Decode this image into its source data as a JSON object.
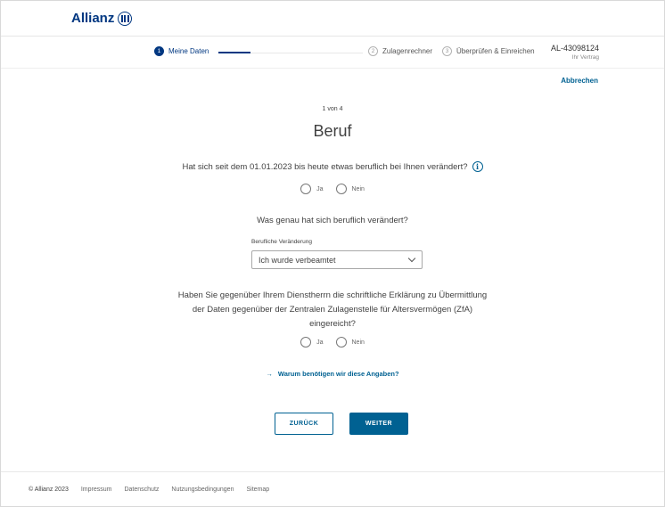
{
  "header": {
    "logo_text": "Allianz"
  },
  "stepper": {
    "steps": [
      {
        "num": "1",
        "label": "Meine Daten"
      },
      {
        "num": "2",
        "label": "Zulagenrechner"
      },
      {
        "num": "3",
        "label": "Überprüfen & Einreichen"
      }
    ]
  },
  "contract": {
    "id": "AL-43098124",
    "label": "Ihr Vertrag"
  },
  "cancel_label": "Abbrechen",
  "main": {
    "counter": "1 von 4",
    "title": "Beruf",
    "question1": "Hat sich seit dem 01.01.2023 bis heute etwas beruflich bei Ihnen verändert?",
    "question1_options": [
      "Ja",
      "Nein"
    ],
    "question2": "Was genau hat sich beruflich verändert?",
    "select": {
      "label": "Berufliche Veränderung",
      "value": "Ich wurde verbeamtet"
    },
    "question3_lines": [
      "Haben Sie gegenüber Ihrem Dienstherrn die schriftliche Erklärung zu Übermittlung",
      "der Daten gegenüber der Zentralen Zulagenstelle für Altersvermögen (ZfA)",
      "eingereicht?"
    ],
    "question3_options": [
      "Ja",
      "Nein"
    ],
    "why_link": "Warum benötigen wir diese Angaben?",
    "back_label": "ZURÜCK",
    "next_label": "WEITER"
  },
  "footer": {
    "copyright": "© Allianz 2023",
    "links": [
      "Impressum",
      "Datenschutz",
      "Nutzungsbedingungen",
      "Sitemap"
    ]
  },
  "colors": {
    "brand": "#003781",
    "accent": "#006192",
    "text": "#414141"
  }
}
